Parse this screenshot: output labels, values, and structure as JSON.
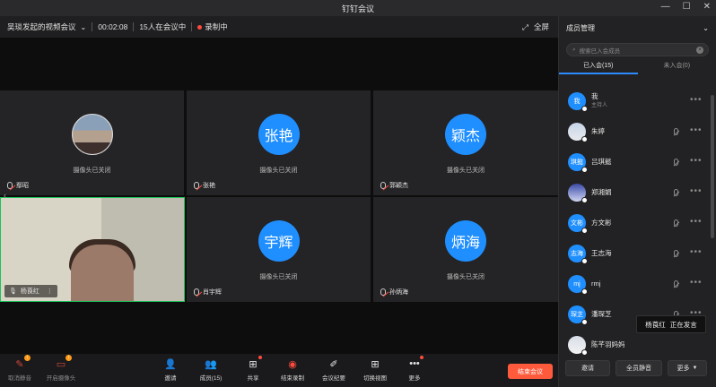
{
  "window": {
    "title": "钉钉会议",
    "minimize": "—",
    "maximize": "☐",
    "close": "✕"
  },
  "topbar": {
    "meeting_title": "吴琰发起的视频会议",
    "duration": "00:02:08",
    "participants_status": "15人在会议中",
    "recording": "录制中",
    "fullscreen": "全屏"
  },
  "tiles": [
    {
      "name": "鄢昭",
      "status": "摄像头已关闭",
      "avatar_text": ""
    },
    {
      "name": "张艳",
      "status": "摄像头已关闭",
      "avatar_text": "张艳"
    },
    {
      "name": "郭颖杰",
      "status": "摄像头已关闭",
      "avatar_text": "颖杰"
    },
    {
      "name": "杨莨红",
      "status": "",
      "avatar_text": ""
    },
    {
      "name": "肖宇辉",
      "status": "摄像头已关闭",
      "avatar_text": "宇辉"
    },
    {
      "name": "孙炳海",
      "status": "摄像头已关闭",
      "avatar_text": "炳海"
    }
  ],
  "toolbar": {
    "mute": "取消静音",
    "camera": "开启摄像头",
    "invite": "邀请",
    "members": "成员(15)",
    "share": "共享",
    "stop_record": "结束录制",
    "minutes": "会议纪要",
    "switch_view": "切换视图",
    "more": "更多",
    "end_meeting": "结束会议",
    "badge": "!"
  },
  "panel": {
    "title": "成员管理",
    "search_placeholder": "搜索已入会成员",
    "tab_joined": "已入会(15)",
    "tab_not_joined": "未入会(0)",
    "members": [
      {
        "name": "我",
        "role": "主持人",
        "avatar": "我"
      },
      {
        "name": "朱婷",
        "role": "",
        "avatar": ""
      },
      {
        "name": "吕琪懿",
        "role": "",
        "avatar": "琪懿"
      },
      {
        "name": "郑湘娟",
        "role": "",
        "avatar": ""
      },
      {
        "name": "方文彬",
        "role": "",
        "avatar": "文彬"
      },
      {
        "name": "王志海",
        "role": "",
        "avatar": "志海"
      },
      {
        "name": "rmj",
        "role": "",
        "avatar": "mj"
      },
      {
        "name": "潘琛芝",
        "role": "",
        "avatar": "琛芝"
      },
      {
        "name": "陈芊羽妈妈",
        "role": "",
        "avatar": ""
      }
    ],
    "tooltip_name": "杨莨红",
    "tooltip_text": "正在发言",
    "btn_invite": "邀请",
    "btn_mute_all": "全员静音",
    "btn_more": "更多"
  }
}
